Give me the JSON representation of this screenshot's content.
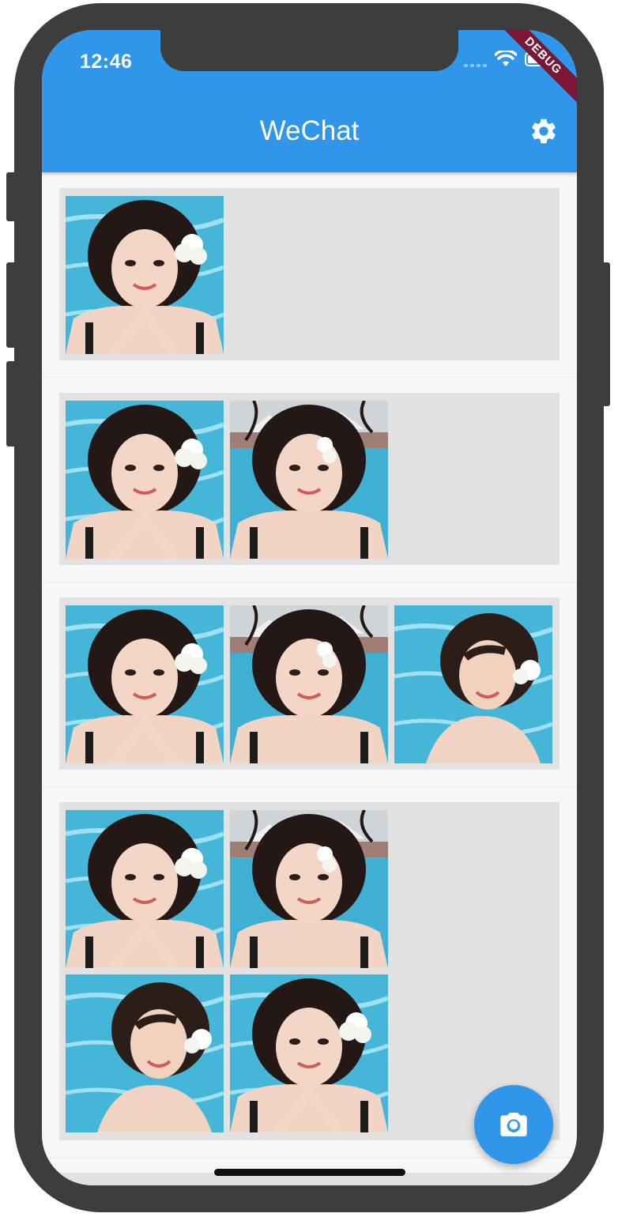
{
  "status_bar": {
    "time": "12:46"
  },
  "app_bar": {
    "title": "WeChat",
    "settings_icon": "gear-icon",
    "debug_banner": "DEBUG"
  },
  "colors": {
    "primary": "#2f96ea",
    "card_bg": "#e2e2e2",
    "debug": "#7b1734"
  },
  "photo_variants": [
    "pool-flower-hands",
    "pool-windblown",
    "pool-looking-up"
  ],
  "posts": [
    {
      "photos": [
        0
      ]
    },
    {
      "photos": [
        0,
        1
      ]
    },
    {
      "photos": [
        0,
        1,
        2
      ]
    },
    {
      "photos": [
        0,
        1,
        2,
        0
      ]
    }
  ],
  "fab": {
    "icon": "camera-icon"
  }
}
